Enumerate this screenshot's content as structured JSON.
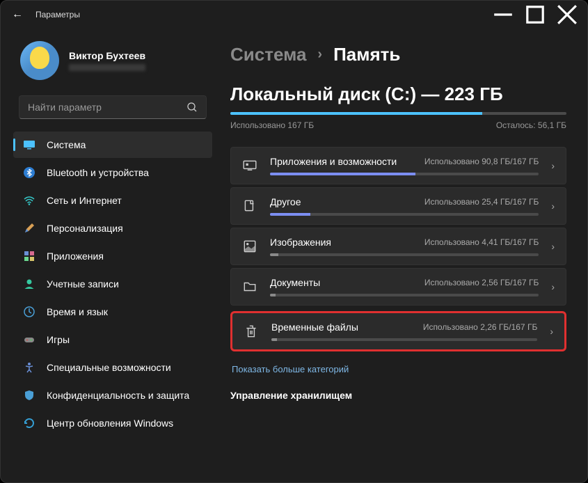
{
  "window": {
    "title": "Параметры"
  },
  "profile": {
    "name": "Виктор Бухтеев"
  },
  "search": {
    "placeholder": "Найти параметр"
  },
  "sidebar": {
    "items": [
      {
        "label": "Система"
      },
      {
        "label": "Bluetooth и устройства"
      },
      {
        "label": "Сеть и Интернет"
      },
      {
        "label": "Персонализация"
      },
      {
        "label": "Приложения"
      },
      {
        "label": "Учетные записи"
      },
      {
        "label": "Время и язык"
      },
      {
        "label": "Игры"
      },
      {
        "label": "Специальные возможности"
      },
      {
        "label": "Конфиденциальность и защита"
      },
      {
        "label": "Центр обновления Windows"
      }
    ]
  },
  "breadcrumb": {
    "root": "Система",
    "sep": "›",
    "current": "Память"
  },
  "disk": {
    "title": "Локальный диск (C:) — 223 ГБ",
    "used_label": "Использовано 167 ГБ",
    "free_label": "Осталось: 56,1 ГБ",
    "fill_pct": 75
  },
  "categories": [
    {
      "title": "Приложения и возможности",
      "usage": "Использовано 90,8 ГБ/167 ГБ",
      "pct": 54,
      "color": "blue"
    },
    {
      "title": "Другое",
      "usage": "Использовано 25,4 ГБ/167 ГБ",
      "pct": 15,
      "color": "blue"
    },
    {
      "title": "Изображения",
      "usage": "Использовано 4,41 ГБ/167 ГБ",
      "pct": 3,
      "color": "gray"
    },
    {
      "title": "Документы",
      "usage": "Использовано 2,56 ГБ/167 ГБ",
      "pct": 2,
      "color": "gray"
    },
    {
      "title": "Временные файлы",
      "usage": "Использовано 2,26 ГБ/167 ГБ",
      "pct": 2,
      "color": "gray",
      "highlight": true
    }
  ],
  "more_link": "Показать больше категорий",
  "section2": "Управление хранилищем"
}
